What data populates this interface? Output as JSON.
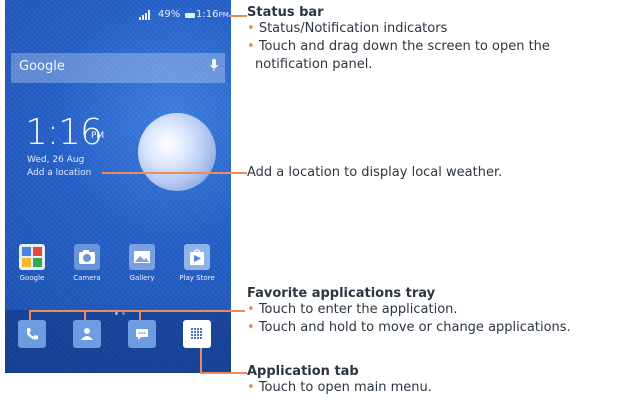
{
  "phone": {
    "status_bar": {
      "signal": "⁩⁩▂▄▆",
      "battery": "49%",
      "time": "1:16",
      "time_suffix": "PM"
    },
    "search": {
      "label": "Google"
    },
    "clock": {
      "time": "1:16",
      "suffix": "PM",
      "date": "Wed, 26 Aug",
      "location": "Add a location"
    },
    "apps": [
      {
        "label": "Google",
        "icon": "google-folder-icon"
      },
      {
        "label": "Camera",
        "icon": "camera-icon"
      },
      {
        "label": "Gallery",
        "icon": "gallery-icon"
      },
      {
        "label": "Play Store",
        "icon": "play-store-icon"
      }
    ],
    "dock": [
      {
        "icon": "phone-icon"
      },
      {
        "icon": "contacts-icon"
      },
      {
        "icon": "messaging-icon"
      },
      {
        "icon": "app-drawer-icon"
      }
    ]
  },
  "annotations": {
    "status_bar": {
      "title": "Status bar",
      "bullets": [
        "Status/Notification indicators",
        "Touch and drag down the screen to open the",
        "notification panel."
      ]
    },
    "weather": {
      "text": "Add a location to display local weather."
    },
    "favorites": {
      "title": "Favorite applications tray",
      "bullets": [
        "Touch to enter the application.",
        "Touch and hold to move or change applications."
      ]
    },
    "app_tab": {
      "title": "Application tab",
      "bullets": [
        "Touch to open main menu."
      ]
    }
  },
  "colors": {
    "accent": "#f08a5d",
    "screen": "#2560c8",
    "text": "#2c3642"
  }
}
